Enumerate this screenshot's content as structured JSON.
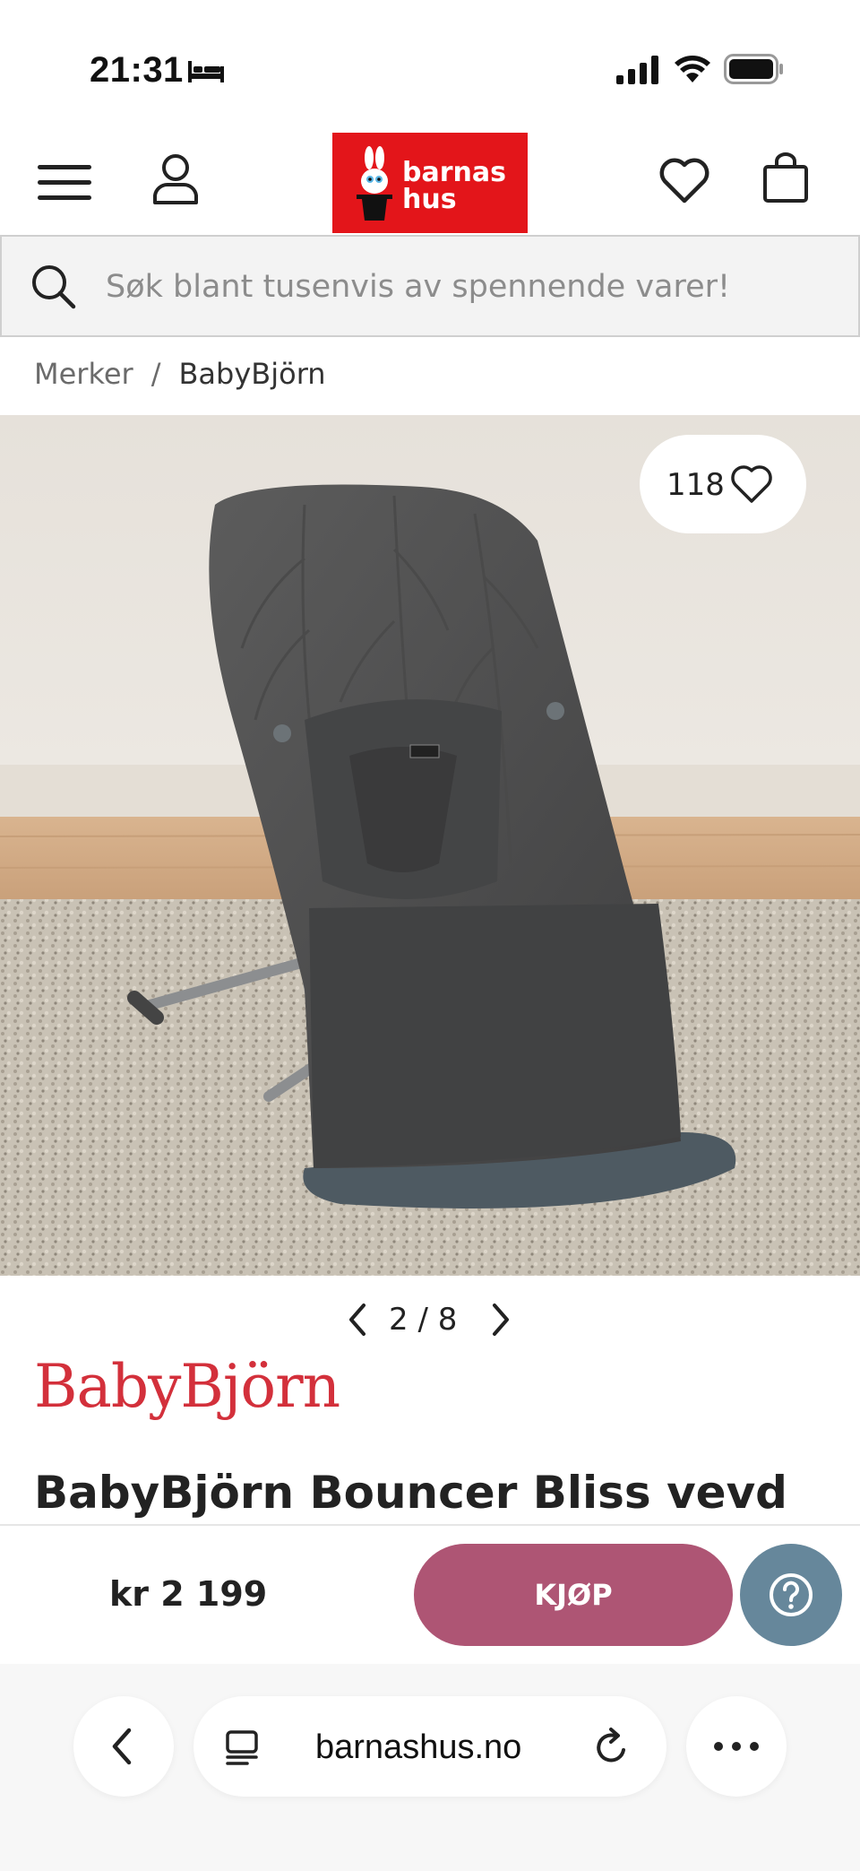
{
  "status_bar": {
    "time": "21:31",
    "icons": [
      "bed-icon",
      "signal-icon",
      "wifi-icon",
      "battery-icon"
    ]
  },
  "header": {
    "logo_text_line1": "barnas",
    "logo_text_line2": "hus",
    "logo_color": "#e3151a",
    "icons": [
      "menu-icon",
      "user-icon",
      "heart-icon",
      "bag-icon"
    ]
  },
  "search": {
    "placeholder": "Søk blant tusenvis av spennende varer!"
  },
  "breadcrumb": {
    "items": [
      "Merker",
      "BabyBjörn"
    ],
    "separator": "/"
  },
  "product": {
    "like_count": "118",
    "pager": "2 / 8",
    "brand_logo": "BabyBjörn",
    "brand_color": "#d3303b",
    "title": "BabyBjörn Bouncer Bliss vevd",
    "price": "kr 2 199",
    "buy_label": "KJØP",
    "buy_color": "#ae5574",
    "help_color": "#66879b"
  },
  "browser": {
    "url": "barnashus.no"
  }
}
